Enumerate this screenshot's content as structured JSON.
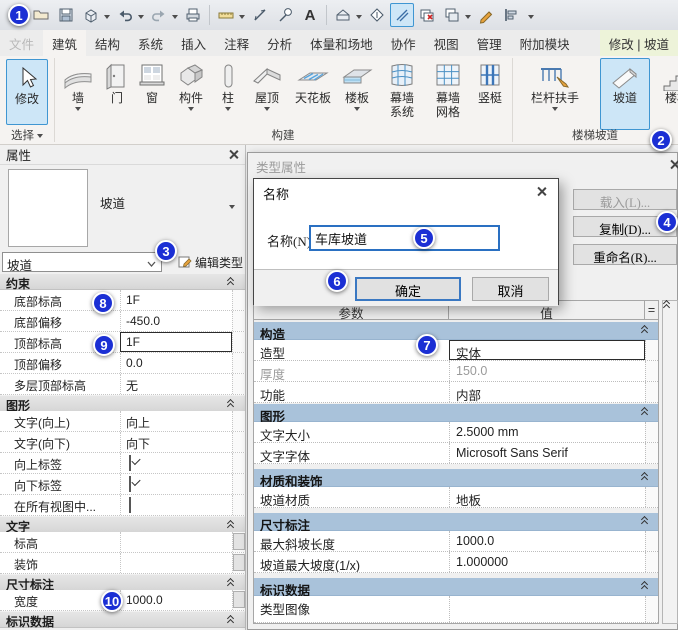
{
  "annotations": {
    "n1": "1",
    "n2": "2",
    "n3": "3",
    "n4": "4",
    "n5": "5",
    "n6": "6",
    "n7": "7",
    "n8": "8",
    "n9": "9",
    "n10": "10"
  },
  "qat": {
    "text_glyph": "A"
  },
  "tabs": {
    "file": "文件",
    "arch": "建筑",
    "struct": "结构",
    "system": "系统",
    "insert": "插入",
    "annotate": "注释",
    "analyze": "分析",
    "mass_site": "体量和场地",
    "collaborate": "协作",
    "view": "视图",
    "manage": "管理",
    "addins": "附加模块",
    "context": "修改 | 坡道"
  },
  "ribbon": {
    "modify": "修改",
    "select_group": "选择",
    "build_group": "构建",
    "circulation_group": "楼梯坡道",
    "wall": "墙",
    "door": "门",
    "window": "窗",
    "component": "构件",
    "column": "柱",
    "roof": "屋顶",
    "ceiling": "天花板",
    "floor": "楼板",
    "curtain_sys_a": "幕墙",
    "curtain_sys_b": "系统",
    "curtain_grid_a": "幕墙",
    "curtain_grid_b": "网格",
    "mullion": "竖梃",
    "railing": "栏杆扶手",
    "ramp": "坡道",
    "stair": "楼梯"
  },
  "props": {
    "title": "属性",
    "type_name": "坡道",
    "type_selector": "坡道",
    "edit_type": "编辑类型",
    "sec_constraints": "约束",
    "base_level_l": "底部标高",
    "base_level_v": "1F",
    "base_offset_l": "底部偏移",
    "base_offset_v": "-450.0",
    "top_level_l": "顶部标高",
    "top_level_v": "1F",
    "top_offset_l": "顶部偏移",
    "top_offset_v": "0.0",
    "multistory_l": "多层顶部标高",
    "multistory_v": "无",
    "sec_graphics": "图形",
    "text_up_l": "文字(向上)",
    "text_up_v": "向上",
    "text_down_l": "文字(向下)",
    "text_down_v": "向下",
    "up_label_l": "向上标签",
    "down_label_l": "向下标签",
    "all_views_l": "在所有视图中...",
    "sec_text": "文字",
    "level_l": "标高",
    "decor_l": "装饰",
    "sec_dims": "尺寸标注",
    "width_l": "宽度",
    "width_v": "1000.0",
    "sec_identity": "标识数据"
  },
  "tp": {
    "title": "类型属性",
    "load": "载入(L)...",
    "duplicate": "复制(D)...",
    "rename": "重命名(R)...",
    "col_param": "参数",
    "col_value": "值",
    "col_eq": "=",
    "sec_construction": "构造",
    "shape_l": "造型",
    "shape_v": "实体",
    "thickness_l": "厚度",
    "thickness_v": "150.0",
    "function_l": "功能",
    "function_v": "内部",
    "sec_graphics": "图形",
    "text_size_l": "文字大小",
    "text_size_v": "2.5000 mm",
    "text_font_l": "文字字体",
    "text_font_v": "Microsoft Sans Serif",
    "sec_materials": "材质和装饰",
    "ramp_material_l": "坡道材质",
    "ramp_material_v": "地板",
    "sec_dims": "尺寸标注",
    "max_run_l": "最大斜坡长度",
    "max_run_v": "1000.0",
    "max_slope_l": "坡道最大坡度(1/x)",
    "max_slope_v": "1.000000",
    "sec_identity": "标识数据",
    "type_image_l": "类型图像"
  },
  "name_dialog": {
    "title": "名称",
    "label": "名称(N):",
    "value": "车库坡道",
    "ok": "确定",
    "cancel": "取消"
  }
}
